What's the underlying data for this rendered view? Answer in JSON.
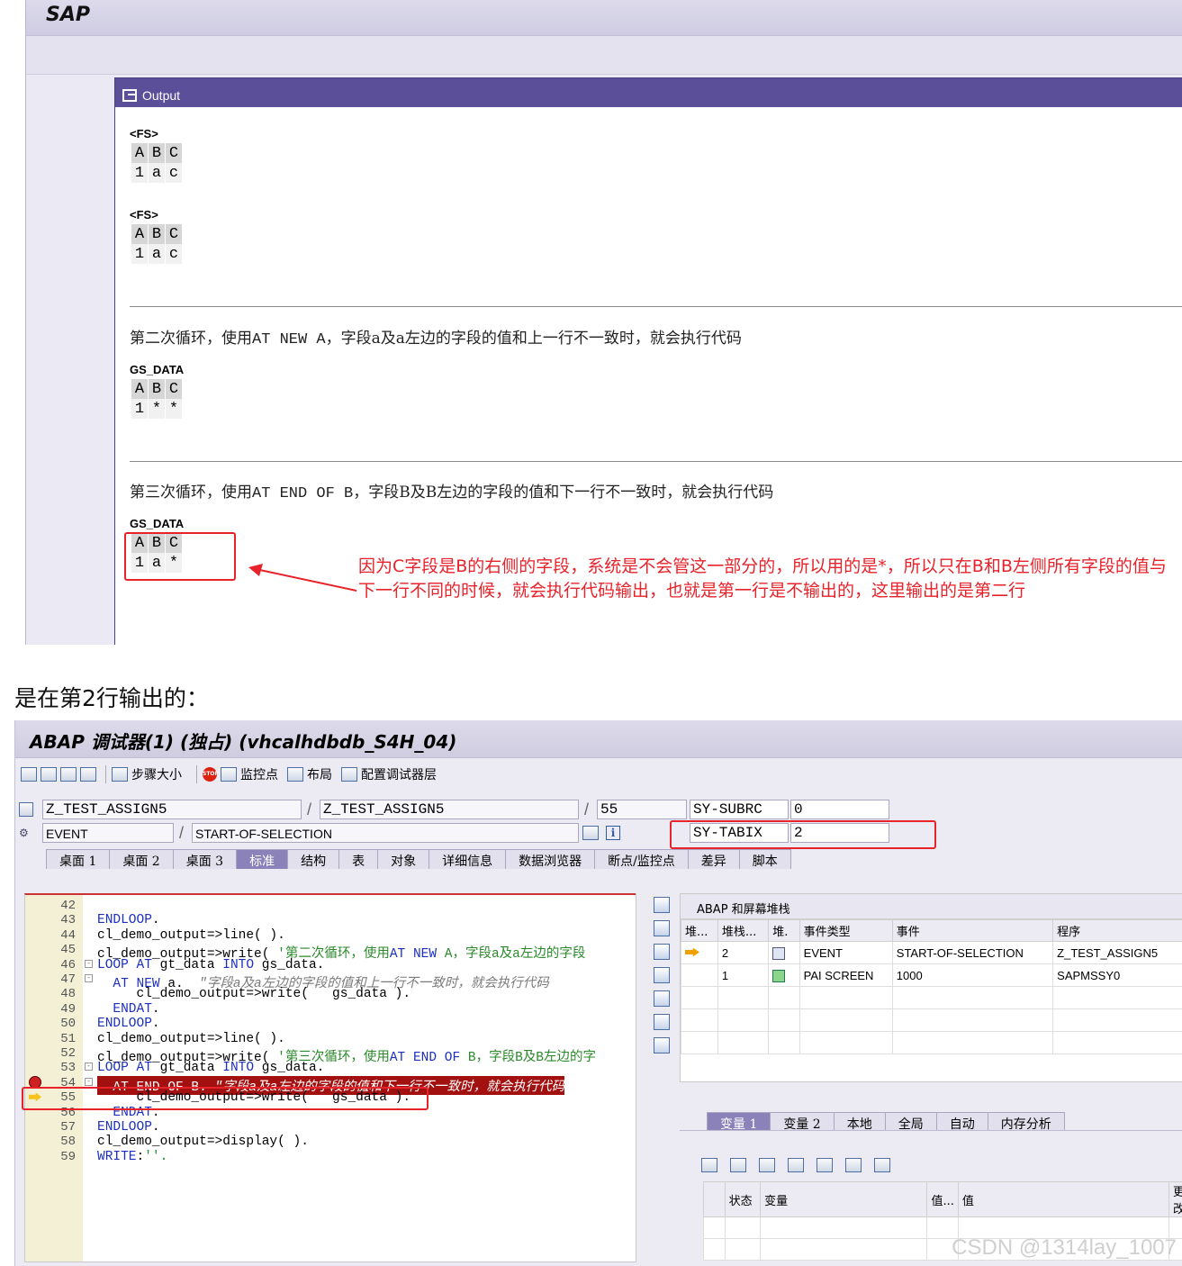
{
  "top_window": {
    "brand": "SAP",
    "output_title": "Output",
    "blocks": [
      {
        "label": "<FS>",
        "header": [
          "A",
          "B",
          "C"
        ],
        "row": [
          "1",
          "a",
          "c"
        ]
      },
      {
        "label": "<FS>",
        "header": [
          "A",
          "B",
          "C"
        ],
        "row": [
          "1",
          "a",
          "c"
        ]
      }
    ],
    "para2_a": "第二次循环，使用",
    "para2_code": "AT NEW A",
    "para2_b": "，字段a及a左边的字段的值和上一行不一致时，就会执行代码",
    "block3": {
      "label": "GS_DATA",
      "header": [
        "A",
        "B",
        "C"
      ],
      "row": [
        "1",
        "*",
        "*"
      ]
    },
    "para3_a": "第三次循环，使用",
    "para3_code": "AT END OF B",
    "para3_b": "，字段B及B左边的字段的值和下一行不一致时，就会执行代码",
    "block4": {
      "label": "GS_DATA",
      "header": [
        "A",
        "B",
        "C"
      ],
      "row": [
        "1",
        "a",
        "*"
      ]
    },
    "annotation": "因为C字段是B的右侧的字段，系统是不会管这一部分的，所以用的是*，所以只在B和B左侧所有字段的值与下一行不同的时候，就会执行代码输出，也就是第一行是不输出的，这里输出的是第二行",
    "annotation_color": "#e8222a"
  },
  "caption": "是在第2行输出的：",
  "debugger": {
    "title": "ABAP 调试器(1) (独占) (vhcalhdbdb_S4H_04)",
    "toolbar": {
      "step_size": "步骤大小",
      "watchpoint": "监控点",
      "layout": "布局",
      "config": "配置调试器层"
    },
    "row1": {
      "program": "Z_TEST_ASSIGN5",
      "include": "Z_TEST_ASSIGN5",
      "line": "55",
      "var_name": "SY-SUBRC",
      "var_value": "0"
    },
    "row2": {
      "event_type": "EVENT",
      "event": "START-OF-SELECTION",
      "var_name": "SY-TABIX",
      "var_value": "2"
    },
    "tabs": [
      "桌面 1",
      "桌面 2",
      "桌面 3",
      "标准",
      "结构",
      "表",
      "对象",
      "详细信息",
      "数据浏览器",
      "断点/监控点",
      "差异",
      "脚本"
    ],
    "code": [
      {
        "n": "42",
        "t": ""
      },
      {
        "n": "43",
        "t": "ENDLOOP."
      },
      {
        "n": "44",
        "t": "cl_demo_output=>line( )."
      },
      {
        "n": "45",
        "t": "cl_demo_output=>write( '第二次循环，使用AT NEW A，字段a及a左边的字段"
      },
      {
        "n": "46",
        "t": "LOOP AT gt_data INTO gs_data."
      },
      {
        "n": "47",
        "t": "  AT NEW a.  \"字段a及a左边的字段的值和上一行不一致时，就会执行代码"
      },
      {
        "n": "48",
        "t": "     cl_demo_output=>write(   gs_data )."
      },
      {
        "n": "49",
        "t": "  ENDAT."
      },
      {
        "n": "50",
        "t": "ENDLOOP."
      },
      {
        "n": "51",
        "t": "cl_demo_output=>line( )."
      },
      {
        "n": "52",
        "t": "cl_demo_output=>write( '第三次循环，使用AT END OF B，字段B及B左边的字"
      },
      {
        "n": "53",
        "t": "LOOP AT gt_data INTO gs_data."
      },
      {
        "n": "54",
        "t": "  AT END OF B. \"字段a及a左边的字段的值和下一行不一致时，就会执行代码"
      },
      {
        "n": "55",
        "t": "     cl_demo_output=>write(   gs_data )."
      },
      {
        "n": "56",
        "t": "  ENDAT."
      },
      {
        "n": "57",
        "t": "ENDLOOP."
      },
      {
        "n": "58",
        "t": "cl_demo_output=>display( )."
      },
      {
        "n": "59",
        "t": "WRITE:''."
      }
    ],
    "stack": {
      "title": "ABAP 和屏幕堆栈",
      "headers": [
        "堆...",
        "堆栈...",
        "堆.",
        "事件类型",
        "事件",
        "程序"
      ],
      "rows": [
        {
          "depth": "2",
          "type": "EVENT",
          "event": "START-OF-SELECTION",
          "program": "Z_TEST_ASSIGN5"
        },
        {
          "depth": "1",
          "type": "PAI SCREEN",
          "event": "1000",
          "program": "SAPMSSY0"
        }
      ]
    },
    "var_tabs": [
      "变量 1",
      "变量 2",
      "本地",
      "全局",
      "自动",
      "内存分析"
    ],
    "var_headers": [
      "状态",
      "变量",
      "值...",
      "值",
      "更改"
    ]
  },
  "watermark": "CSDN @1314lay_1007"
}
